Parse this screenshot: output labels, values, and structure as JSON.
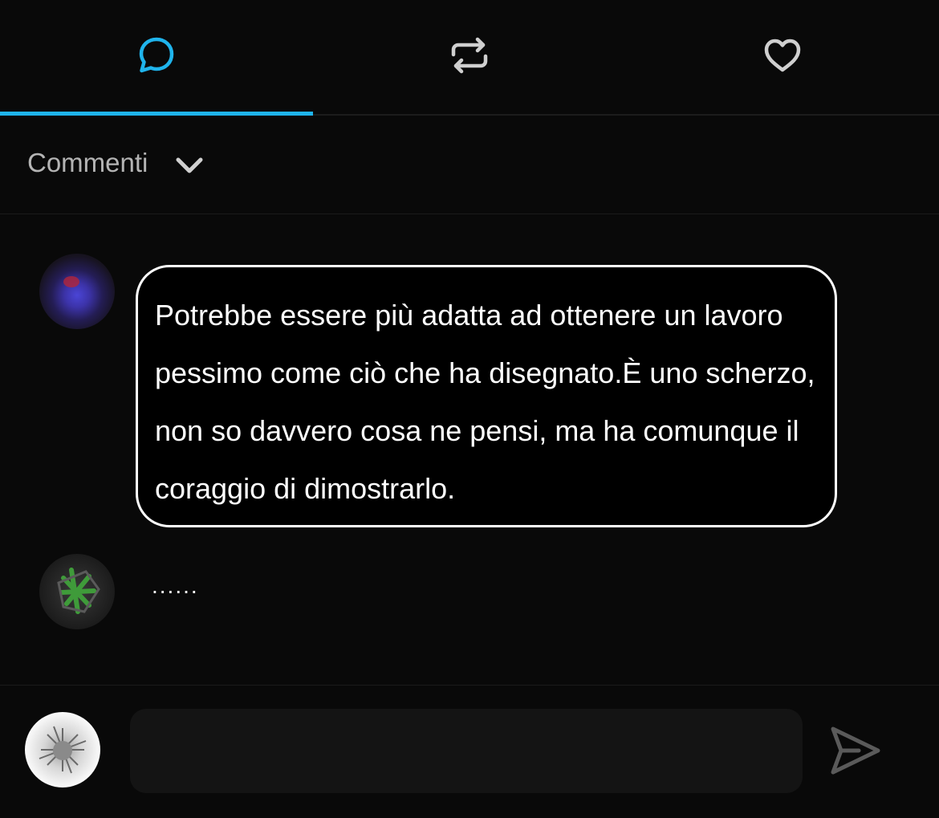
{
  "tabs": [
    {
      "icon": "comment-icon",
      "active": true,
      "color": "#1fb4ec"
    },
    {
      "icon": "repost-icon",
      "active": false,
      "color": "#cfcfcf"
    },
    {
      "icon": "heart-icon",
      "active": false,
      "color": "#cfcfcf"
    }
  ],
  "filter": {
    "label": "Commenti",
    "icon": "chevron-down-icon"
  },
  "comments": [
    {
      "avatar": "avatar-blue",
      "text": "Potrebbe essere più adatta ad ottenere un lavoro pessimo come ciò che ha disegnato.È uno scherzo, non so davvero cosa ne pensi, ma ha comunque il coraggio di dimostrarlo."
    },
    {
      "avatar": "avatar-green",
      "text": "......"
    }
  ],
  "composer": {
    "avatar": "avatar-white",
    "placeholder": "",
    "value": "",
    "send_icon": "send-icon"
  },
  "colors": {
    "background": "#090909",
    "accent": "#1fb4ec",
    "bubble_border": "#ffffff",
    "input_bg": "#141414"
  }
}
